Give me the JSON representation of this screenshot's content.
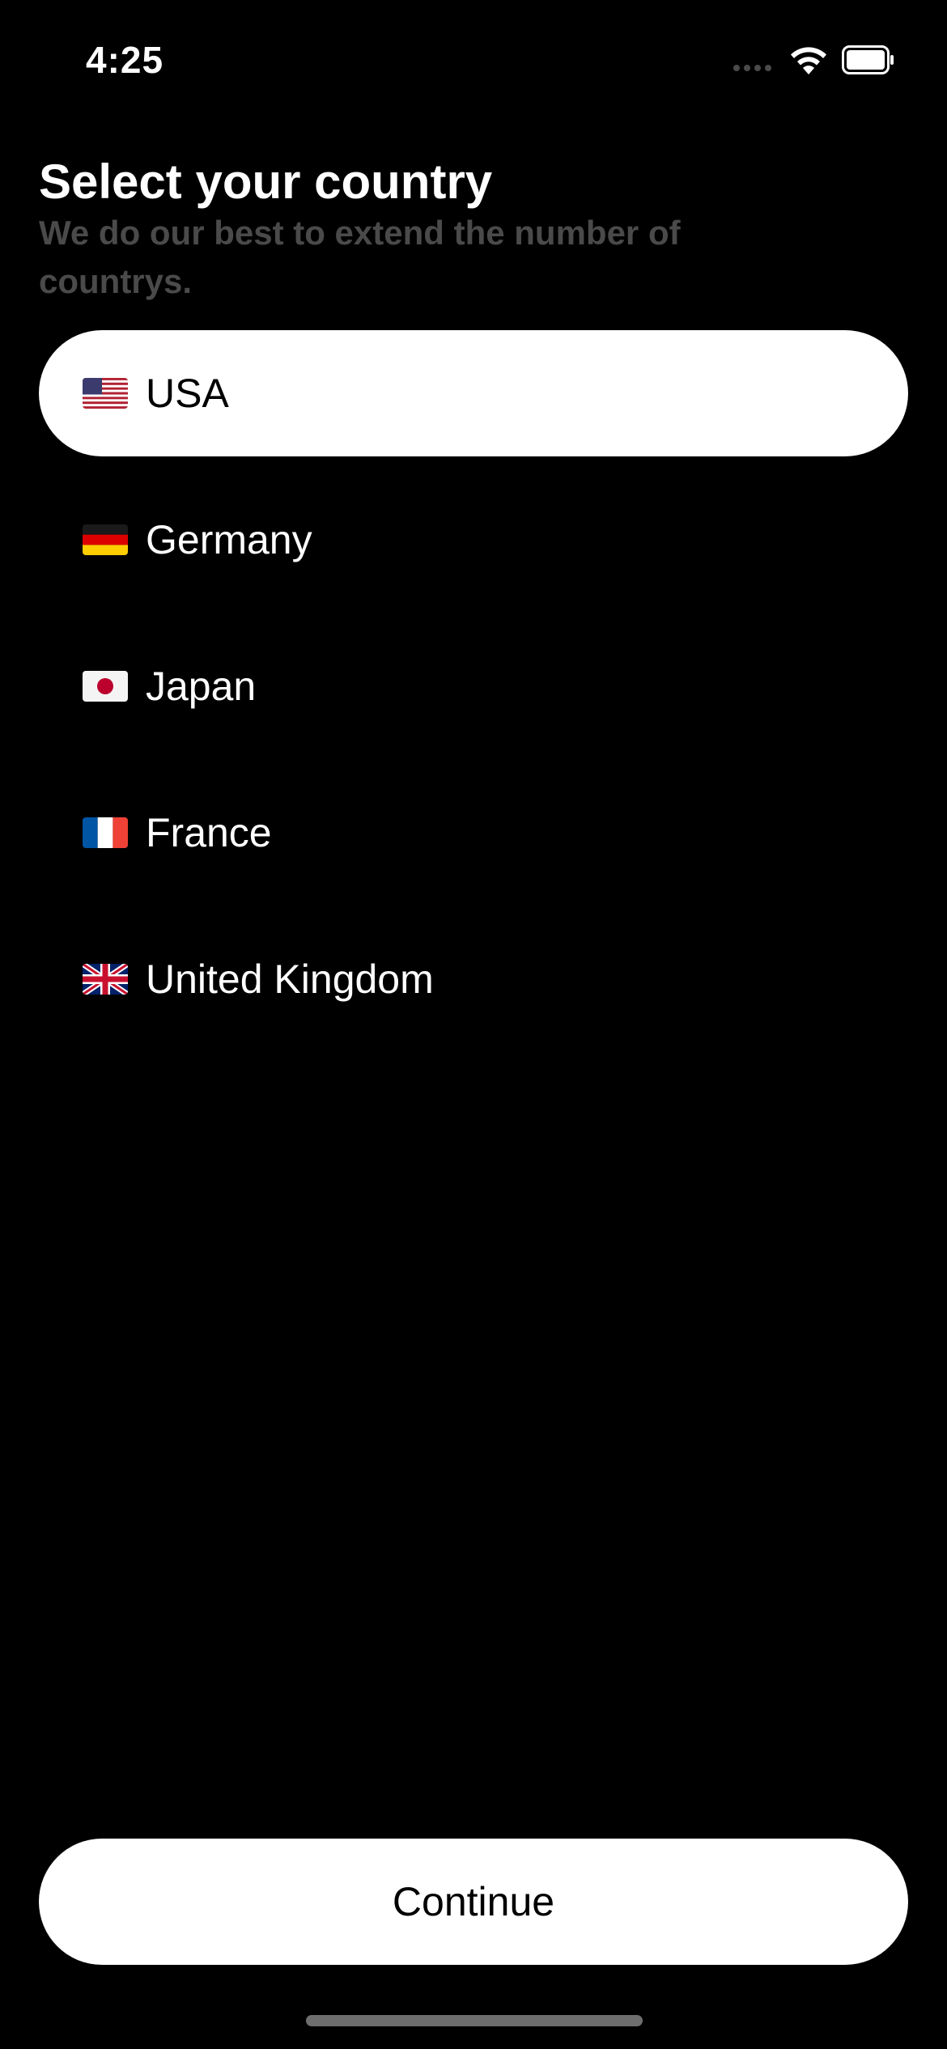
{
  "status_bar": {
    "time": "4:25",
    "signal_icon": "signal-dots-icon",
    "wifi_icon": "wifi-icon",
    "battery_icon": "battery-icon"
  },
  "header": {
    "title": "Select your country",
    "subtitle": "We do our best to extend the number of countrys."
  },
  "countries": [
    {
      "label": "USA",
      "flag_icon": "flag-us-icon",
      "selected": true
    },
    {
      "label": "Germany",
      "flag_icon": "flag-de-icon",
      "selected": false
    },
    {
      "label": "Japan",
      "flag_icon": "flag-jp-icon",
      "selected": false
    },
    {
      "label": "France",
      "flag_icon": "flag-fr-icon",
      "selected": false
    },
    {
      "label": "United Kingdom",
      "flag_icon": "flag-gb-icon",
      "selected": false
    }
  ],
  "continue_button": {
    "label": "Continue"
  },
  "colors": {
    "background": "#000000",
    "selected_background": "#ffffff",
    "subtitle": "#4a4a4a",
    "home_indicator": "#6e6e6e"
  }
}
